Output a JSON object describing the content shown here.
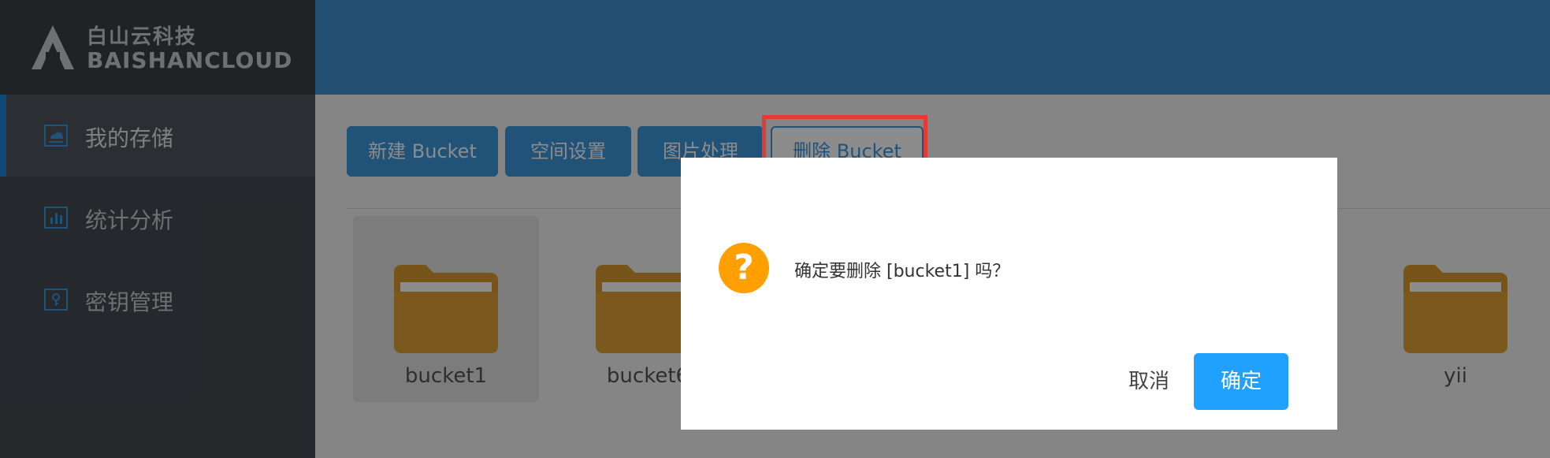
{
  "logo": {
    "cn": "白山云科技",
    "en": "BAISHANCLOUD"
  },
  "sidebar": {
    "items": [
      {
        "label": "我的存储",
        "icon": "storage-icon",
        "active": true
      },
      {
        "label": "统计分析",
        "icon": "bar-chart-icon",
        "active": false
      },
      {
        "label": "密钥管理",
        "icon": "key-icon",
        "active": false
      }
    ]
  },
  "toolbar": {
    "new_bucket": "新建 Bucket",
    "space_settings": "空间设置",
    "image_processing": "图片处理",
    "delete_bucket": "删除 Bucket"
  },
  "buckets": [
    {
      "name": "bucket1",
      "selected": true
    },
    {
      "name": "bucket6",
      "selected": false
    },
    {
      "name": "yii",
      "selected": false
    }
  ],
  "dialog": {
    "icon": "question-icon",
    "icon_glyph": "?",
    "message": "确定要删除 [bucket1] 吗？",
    "cancel": "取消",
    "confirm": "确定"
  },
  "colors": {
    "sidebar": "#444a50",
    "header": "#3f8fd0",
    "primary": "#3d95da",
    "confirm": "#20a0ff",
    "warning": "#ff9f00",
    "highlight": "#e53935",
    "folder": "#e0a237"
  }
}
